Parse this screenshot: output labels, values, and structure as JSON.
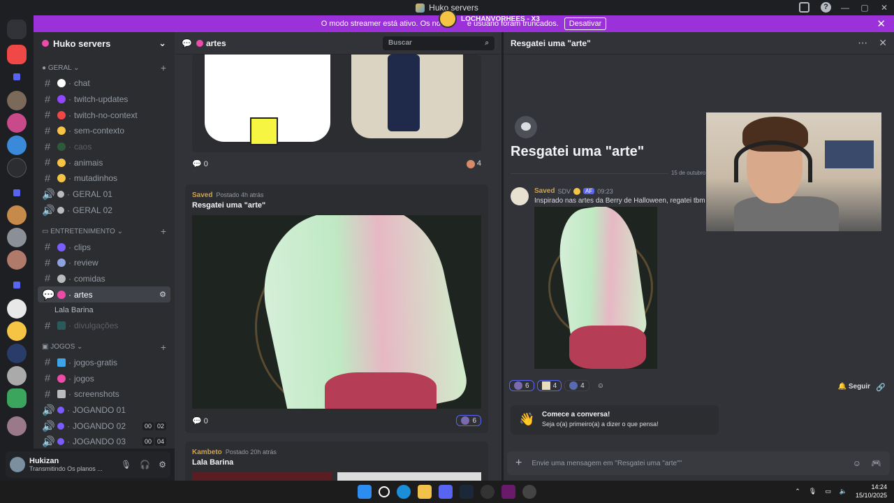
{
  "window": {
    "title": "Huko servers",
    "minimize": "—",
    "maximize": "▢",
    "close": "✕"
  },
  "streamer_overlay": {
    "name": "LOCHANVORHEES - X3"
  },
  "banner": {
    "text": "O modo streamer está ativo. Os no",
    "text_hidden_tail": "e usuário foram truncados.",
    "button": "Desativar"
  },
  "server": {
    "name": "Huko servers"
  },
  "categories": [
    {
      "name": "GERAL",
      "channels": [
        {
          "type": "text",
          "label": "chat",
          "emoji_color": "#ffffff"
        },
        {
          "type": "text",
          "label": "twitch-updates",
          "emoji_color": "#9146ff"
        },
        {
          "type": "text",
          "label": "twitch-no-context",
          "emoji_color": "#f04747"
        },
        {
          "type": "text",
          "label": "sem-contexto",
          "emoji_color": "#f6c445"
        },
        {
          "type": "text",
          "label": "caos",
          "emoji_color": "#3ba55d",
          "muted": true
        },
        {
          "type": "text",
          "label": "animais",
          "emoji_color": "#f6c445"
        },
        {
          "type": "text",
          "label": "mutadinhos",
          "emoji_color": "#f6c445"
        },
        {
          "type": "voice",
          "label": "GERAL 01"
        },
        {
          "type": "voice",
          "label": "GERAL 02"
        }
      ]
    },
    {
      "name": "ENTRETENIMENTO",
      "channels": [
        {
          "type": "text",
          "label": "clips",
          "emoji_color": "#7a5cff"
        },
        {
          "type": "text",
          "label": "review",
          "emoji_color": "#8ea1e1"
        },
        {
          "type": "text",
          "label": "comidas",
          "emoji_color": "#b9bbbe"
        },
        {
          "type": "forum",
          "label": "artes",
          "emoji_color": "#ed4ba8",
          "active": true
        },
        {
          "type": "thread",
          "label": "Lala Barina"
        },
        {
          "type": "text",
          "label": "divulgações",
          "emoji_color": "#3ba5a5",
          "muted": true
        }
      ]
    },
    {
      "name": "JOGOS",
      "channels": [
        {
          "type": "text",
          "label": "jogos-gratis",
          "emoji_color": "#3ba5e5"
        },
        {
          "type": "text",
          "label": "jogos",
          "emoji_color": "#ed4ba8"
        },
        {
          "type": "text",
          "label": "screenshots",
          "emoji_color": "#b9bbbe"
        },
        {
          "type": "voice",
          "label": "JOGANDO 01"
        },
        {
          "type": "voice",
          "label": "JOGANDO 02",
          "counts": [
            "00",
            "02"
          ]
        },
        {
          "type": "voice",
          "label": "JOGANDO 03",
          "counts": [
            "00",
            "04"
          ]
        }
      ]
    }
  ],
  "user_panel": {
    "name": "Hukizan",
    "status": "Transmitindo Os planos ..."
  },
  "forum": {
    "channel": "artes",
    "search_placeholder": "Buscar",
    "post_top": {
      "comments": "0",
      "reaction_count": "4"
    },
    "posts": [
      {
        "author": "Saved",
        "time": "Postado 4h atrás",
        "title": "Resgatei uma \"arte\"",
        "comments": "0",
        "reaction_count": "6"
      },
      {
        "author": "Kambeto",
        "time": "Postado 20h atrás",
        "title": "Lala Barina"
      }
    ]
  },
  "thread": {
    "header": "Resgatei uma \"arte\"",
    "title": "Resgatei uma \"arte\"",
    "date_divider": "15 de outubro d",
    "message": {
      "author": "Saved",
      "tag1": "SDV",
      "tag2": "AF",
      "time": "09:23",
      "text": "Inspirado nas artes da Berry de Halloween, regatei tbm um"
    },
    "reactions": [
      {
        "count": "6"
      },
      {
        "count": "4"
      },
      {
        "count": "4"
      }
    ],
    "follow_label": "Seguir",
    "cta_title": "Comece a conversa!",
    "cta_sub": "Seja o(a) primeiro(a) a dizer o que pensa!",
    "composer_placeholder": "Envie uma mensagem em \"Resgatei uma \"arte\"\""
  },
  "taskbar": {
    "time": "14:24",
    "date": "15/10/2025"
  },
  "colors": {
    "accent": "#5865f2",
    "banner": "#9b32d9",
    "author": "#d1a44a"
  }
}
